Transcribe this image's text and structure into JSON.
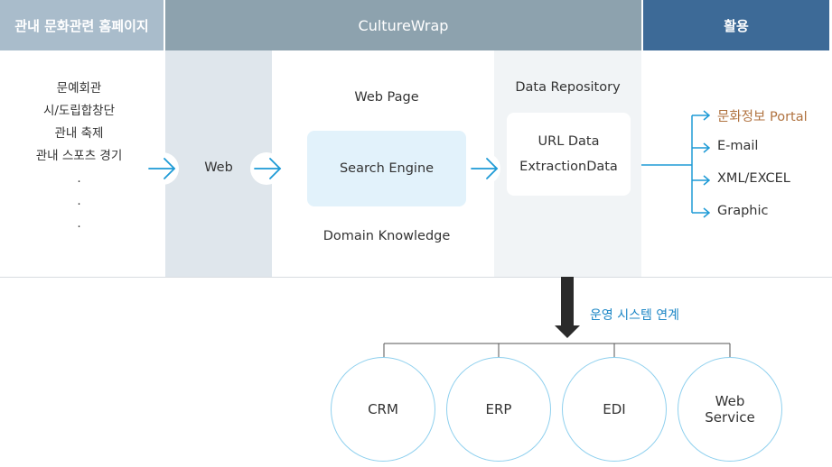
{
  "header": {
    "left": "관내 문화관련 홈페이지",
    "center": "CultureWrap",
    "right": "활용"
  },
  "sources": [
    "문예회관",
    "시/도립합창단",
    "관내 축제",
    "관내 스포츠 경기",
    ".",
    ".",
    "."
  ],
  "web_label": "Web",
  "web_page_label": "Web Page",
  "search_engine_label": "Search Engine",
  "domain_knowledge_label": "Domain Knowledge",
  "repository": {
    "title": "Data Repository",
    "url_data": "URL Data",
    "extraction_data": "ExtractionData"
  },
  "outputs": [
    "문화정보 Portal",
    "E-mail",
    "XML/EXCEL",
    "Graphic"
  ],
  "ops_label": "운영 시스템 연계",
  "systems": [
    "CRM",
    "ERP",
    "EDI",
    "Web\nService"
  ],
  "colors": {
    "header_left": "#a9bccb",
    "header_center": "#8da2ae",
    "header_right": "#3d6a97",
    "arrow_blue": "#1d9ad6",
    "portal_text": "#b0723f",
    "circle_border": "#8fd0ee"
  }
}
